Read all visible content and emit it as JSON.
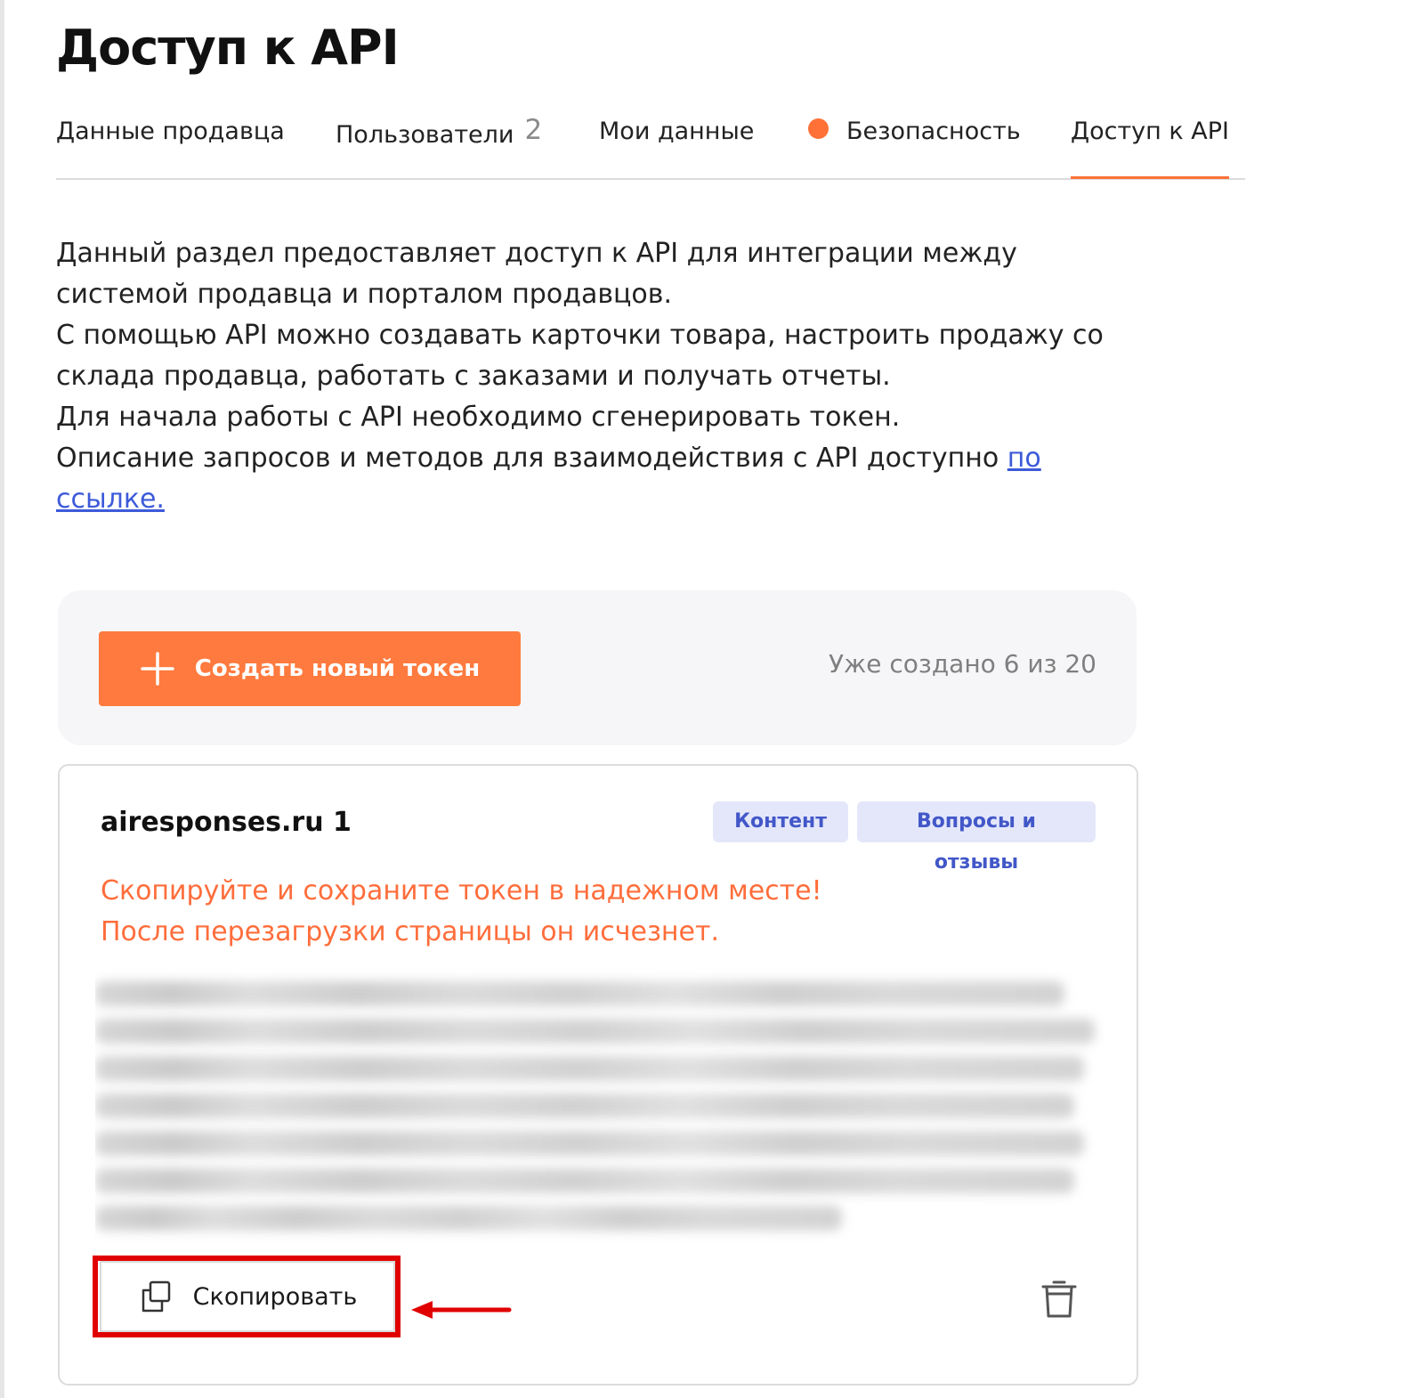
{
  "page": {
    "title": "Доступ к API"
  },
  "tabs": [
    {
      "label": "Данные продавца"
    },
    {
      "label": "Пользователи",
      "count": "2"
    },
    {
      "label": "Мои данные"
    },
    {
      "label": "Безопасность"
    },
    {
      "label": "Доступ к API"
    }
  ],
  "intro": {
    "line1": "Данный раздел предоставляет доступ к API для интеграции между системой продавца и порталом продавцов.",
    "line2": "С помощью API можно создавать карточки товара, настроить продажу со склада продавца, работать с заказами и получать отчеты.",
    "line3": "Для начала работы с API необходимо сгенерировать токен.",
    "line4_text": "Описание запросов и методов для взаимодействия с API доступно ",
    "line4_link": "по ссылке."
  },
  "create_panel": {
    "button_label": "Создать новый токен",
    "created_count": "Уже создано 6 из 20"
  },
  "token_card": {
    "name": "airesponses.ru 1",
    "tags": [
      "Контент",
      "Вопросы и отзывы"
    ],
    "warning_line1": "Скопируйте и сохраните токен в надежном месте!",
    "warning_line2": "После перезагрузки страницы он исчезнет.",
    "copy_label": "Скопировать"
  },
  "colors": {
    "accent": "#ff7a3e",
    "tab_dot": "#ff7137",
    "warning": "#ff6d3b",
    "link": "#3d5ad9",
    "tag_bg": "#e4e7fa",
    "tag_text": "#4257c8",
    "highlight": "#e00000"
  },
  "icons": {
    "create": "plus-icon",
    "copy": "copy-icon",
    "delete": "trash-icon",
    "annotation": "red-arrow"
  }
}
